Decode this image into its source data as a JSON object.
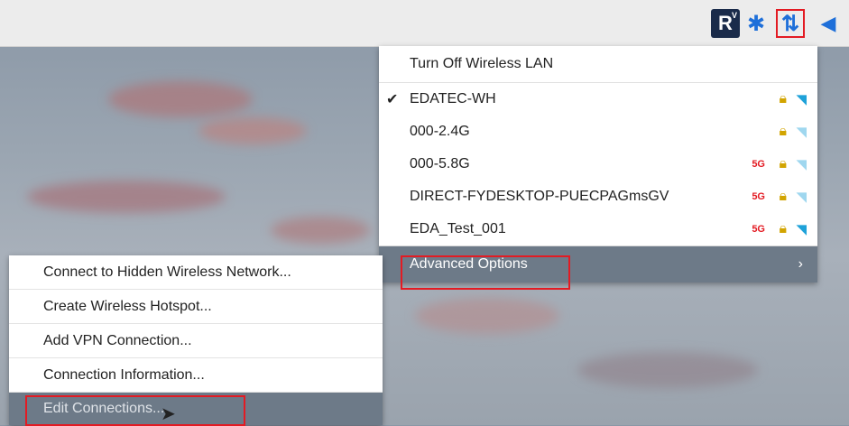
{
  "tray": {
    "vnc_label": "R",
    "bluetooth_glyph": "✱",
    "network_glyph": "⇅",
    "volume_glyph": "◀"
  },
  "network_menu": {
    "toggle_label": "Turn Off Wireless LAN",
    "networks": [
      {
        "ssid": "EDATEC-WH",
        "connected": true,
        "band": "",
        "secured": true,
        "signal": "strong"
      },
      {
        "ssid": "000-2.4G",
        "connected": false,
        "band": "",
        "secured": true,
        "signal": "weak"
      },
      {
        "ssid": "000-5.8G",
        "connected": false,
        "band": "5G",
        "secured": true,
        "signal": "weak"
      },
      {
        "ssid": "DIRECT-FYDESKTOP-PUECPAGmsGV",
        "connected": false,
        "band": "5G",
        "secured": true,
        "signal": "weak"
      },
      {
        "ssid": "EDA_Test_001",
        "connected": false,
        "band": "5G",
        "secured": true,
        "signal": "strong"
      }
    ],
    "advanced_label": "Advanced Options"
  },
  "advanced_submenu": {
    "items": [
      "Connect to Hidden Wireless Network...",
      "Create Wireless Hotspot...",
      "Add VPN Connection...",
      "Connection Information...",
      "Edit Connections..."
    ]
  },
  "colors": {
    "highlight": "#6d7a88",
    "annotation": "#e31b23",
    "accent": "#1e6fd9"
  }
}
